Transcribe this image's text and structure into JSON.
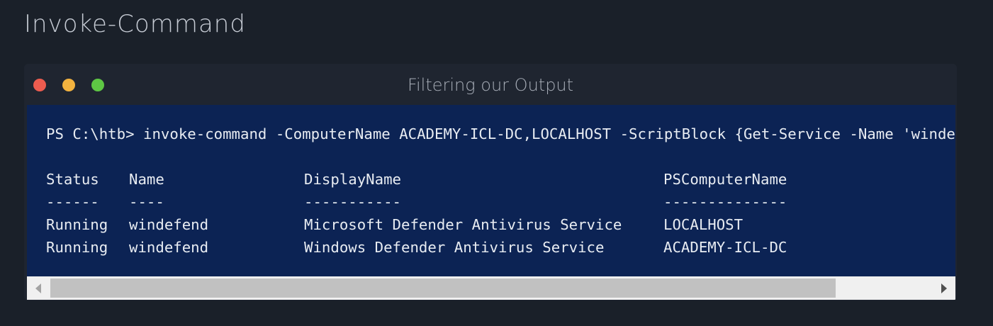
{
  "page": {
    "heading": "Invoke-Command"
  },
  "window": {
    "title": "Filtering our Output",
    "controls": [
      "close",
      "minimize",
      "maximize"
    ]
  },
  "terminal": {
    "command": "PS C:\\htb> invoke-command -ComputerName ACADEMY-ICL-DC,LOCALHOST -ScriptBlock {Get-Service -Name 'windefend'}",
    "table": {
      "headers": [
        "Status",
        "Name",
        "DisplayName",
        "PSComputerName"
      ],
      "separators": [
        "------",
        "----",
        "-----------",
        "--------------"
      ],
      "rows": [
        [
          "Running",
          "windefend",
          "Microsoft Defender Antivirus Service",
          "LOCALHOST"
        ],
        [
          "Running",
          "windefend",
          "Windows Defender Antivirus Service",
          "ACADEMY-ICL-DC"
        ]
      ]
    }
  },
  "scrollbar": {
    "left_icon": "chevron-left-icon",
    "right_icon": "chevron-right-icon",
    "position": 0
  },
  "colors": {
    "background": "#1a2029",
    "window": "#1f2530",
    "terminal_bg": "#0c2354",
    "terminal_text": "#e8ecf2",
    "close": "#ed5c4f",
    "minimize": "#f3b33f",
    "maximize": "#5ec744"
  }
}
